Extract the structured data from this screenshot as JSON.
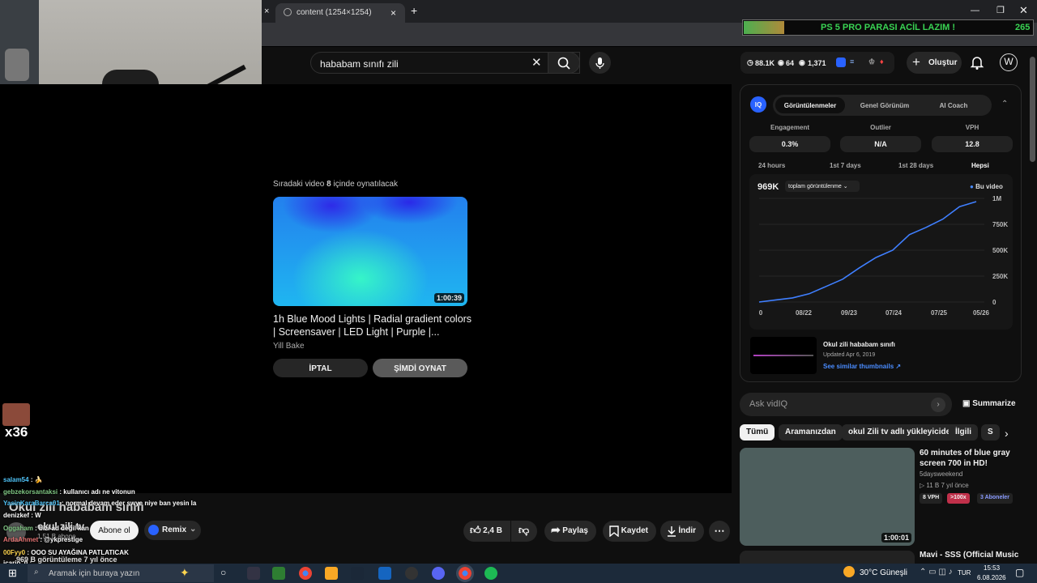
{
  "browser": {
    "tab_title": "content (1254×1254)",
    "close_glyph": "×",
    "new_tab_glyph": "+"
  },
  "donation": {
    "text": "PS 5 PRO PARASI ACİL LAZIM !",
    "count": "265"
  },
  "search": {
    "query": "hababam sınıfı zili"
  },
  "header": {
    "stats": [
      "88.1K",
      "64",
      "1,371"
    ],
    "create_label": "Oluştur"
  },
  "player": {
    "next_label_prefix": "Sıradaki video ",
    "countdown": "8",
    "next_label_suffix": " içinde oynatılacak",
    "duration": "1:00:39",
    "title_line1": "1h Blue Mood Lights | Radial gradient colors",
    "title_line2": "| Screensaver | LED Light | Purple |...",
    "channel": "Yill Bake",
    "cancel": "İPTAL",
    "play_now": "ŞİMDİ OYNAT"
  },
  "video": {
    "title": "Okul zili hababam sınıfı",
    "channel": "okul zili tv",
    "subs": "1,51 B abone",
    "subscribe": "Abone ol",
    "remix": "Remix",
    "meta": "969 B görüntüleme  7 yıl önce"
  },
  "actions": {
    "likes": "2,4 B",
    "share": "Paylaş",
    "save": "Kaydet",
    "download": "İndir"
  },
  "vidiq": {
    "tabs": [
      "Görüntülenmeler",
      "Genel Görünüm",
      "AI Coach"
    ],
    "metrics": [
      {
        "label": "Engagement",
        "value": "0.3%"
      },
      {
        "label": "Outlier",
        "value": "N/A"
      },
      {
        "label": "VPH",
        "value": "12.8"
      }
    ],
    "ranges": [
      "24 hours",
      "1st 7 days",
      "1st 28 days",
      "Hepsi"
    ],
    "total": "969K",
    "total_label": "toplam görüntülenme",
    "legend": "Bu video",
    "related": {
      "title": "Okul zili hababam sınıfı",
      "updated": "Updated Apr 6, 2019",
      "link": "See similar thumbnails ↗"
    }
  },
  "chart_data": {
    "type": "line",
    "title": "",
    "x": [
      "0",
      "08/22",
      "09/23",
      "07/24",
      "07/25",
      "05/26"
    ],
    "y_ticks": [
      "0",
      "250K",
      "500K",
      "750K",
      "1M"
    ],
    "ylim": [
      0,
      1000000
    ],
    "series": [
      {
        "name": "Bu video",
        "values": [
          0,
          20000,
          40000,
          80000,
          150000,
          220000,
          330000,
          430000,
          500000,
          650000,
          720000,
          800000,
          920000,
          969000
        ]
      }
    ]
  },
  "ask": {
    "placeholder": "Ask vidIQ",
    "summarize": "Summarize"
  },
  "chips": [
    "Tümü",
    "Aramanızdan",
    "okul Zili tv adlı yükleyiciden",
    "İlgili",
    "S"
  ],
  "recommend": [
    {
      "title": "60 minutes of blue gray screen 700 in HD!",
      "channel": "5daysweekend",
      "meta": "▷ 11 B  7 yıl önce",
      "duration": "1:00:01",
      "badges": [
        "8 VPH",
        ">100x",
        "3 Aboneler"
      ]
    },
    {
      "title": "Mavi - SSS (Official Music"
    }
  ],
  "chat": [
    {
      "user": "salam54",
      "msg": " : 🍌",
      "color": "#4fc3f7"
    },
    {
      "user": "gebzekorsantaksi",
      "msg": " : kullanıcı adı ne vitonun",
      "color": "#81c784"
    },
    {
      "user": "YasinKaraBarca01",
      "msg": " : normal devam eder swye niye ban yesin la",
      "color": "#4fc3f7"
    },
    {
      "user": "denizkef",
      "msg": " : W",
      "color": "#fff"
    },
    {
      "user": "Oggaham",
      "msg": " : bizi ad değil kan",
      "color": "#81c784"
    },
    {
      "user": "ArdaAhmet",
      "msg": " : @ykprestige",
      "color": "#e57373"
    },
    {
      "user": "00Fyy0",
      "msg": " : OOO SU AYAĞINA PATLATICAK",
      "color": "#ffd54f"
    },
    {
      "user": "icario_0",
      "msg": " :",
      "color": "#fff"
    }
  ],
  "overlay": {
    "combo": "x36"
  },
  "taskbar": {
    "search": "Aramak için buraya yazın",
    "weather": "30°C  Güneşli",
    "lang": "TUR",
    "time": "15:53",
    "date": "6.08.2026"
  }
}
